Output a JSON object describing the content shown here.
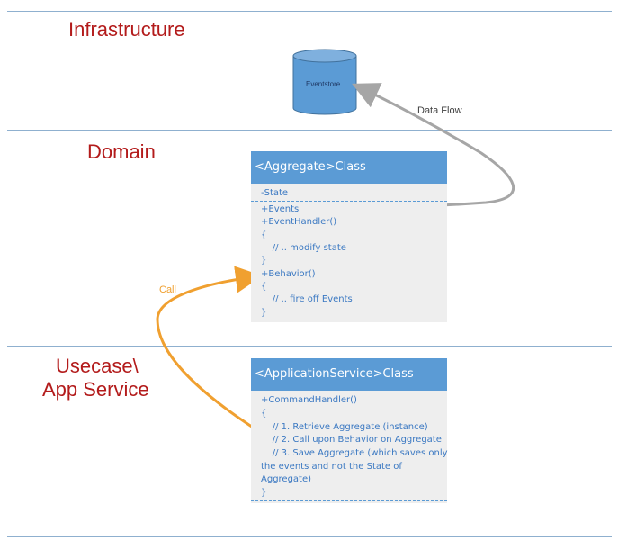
{
  "layers": [
    {
      "title_lines": [
        "Infrastructure"
      ]
    },
    {
      "title_lines": [
        "Domain"
      ]
    },
    {
      "title_lines": [
        "Usecase\\",
        "App Service"
      ]
    }
  ],
  "eventstore": {
    "label": "Eventstore",
    "fill": "#5b9bd5"
  },
  "aggregate": {
    "header": "<Aggregate>Class",
    "state": "-State",
    "lines": [
      "+Events",
      "+EventHandler()",
      "{",
      "    // .. modify state",
      "}",
      "+Behavior()",
      "{",
      "    // .. fire off Events",
      "}"
    ]
  },
  "app_service": {
    "header": "<ApplicationService>Class",
    "lines": [
      "+CommandHandler()",
      "{",
      "    // 1. Retrieve Aggregate (instance)",
      "    // 2. Call upon Behavior on Aggregate",
      "    // 3. Save Aggregate (which saves only",
      "the events and not the State of",
      "Aggregate)",
      "}"
    ]
  },
  "arrows": {
    "data_flow": {
      "label": "Data Flow",
      "color": "#a6a6a6"
    },
    "call": {
      "label": "Call",
      "color": "#f0a030"
    }
  },
  "colors": {
    "layer_title": "#b31b1b",
    "uml_header": "#5b9bd5",
    "uml_body": "#eeeeee",
    "uml_text": "#3a78c2"
  }
}
